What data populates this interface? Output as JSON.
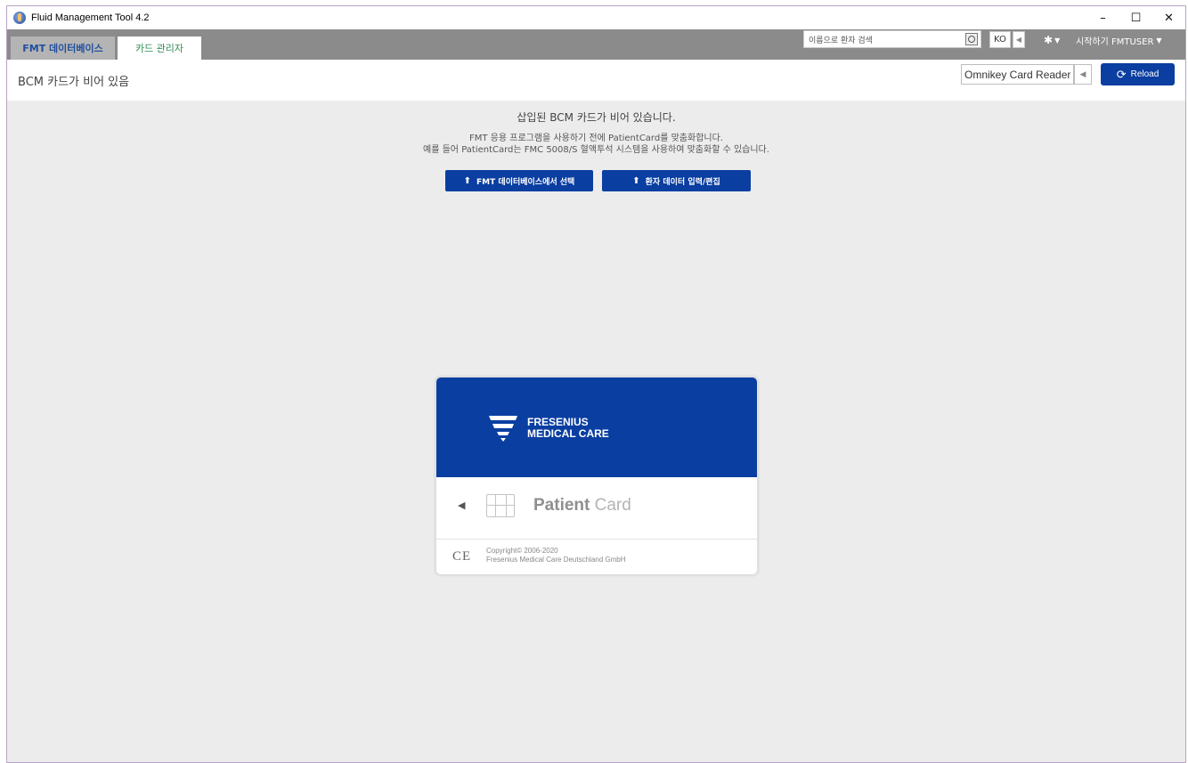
{
  "window": {
    "title": "Fluid Management Tool 4.2",
    "controls": {
      "minimize": "–",
      "maximize": "☐",
      "close": "✕"
    }
  },
  "tabs": [
    {
      "label": "FMT 데이터베이스",
      "active": false
    },
    {
      "label": "카드 관리자",
      "active": true
    }
  ],
  "header": {
    "search_placeholder": "이름으로 환자 검색",
    "language": "KO",
    "user_label": "시작하기 FMTUSER"
  },
  "subheader": {
    "status": "BCM 카드가 비어 있음",
    "reader": "Omnikey Card Reader",
    "reload_label": "Reload"
  },
  "message": {
    "title": "삽입된 BCM 카드가 비어 있습니다.",
    "line1": "FMT 응용 프로그램을 사용하기 전에 PatientCard를 맞춤화합니다.",
    "line2": "예를 들어 PatientCard는 FMC 5008/S 혈액투석 시스템을 사용하여 맞춤화할 수 있습니다."
  },
  "actions": {
    "select_from_db": "FMT 데이터베이스에서 선택",
    "edit_patient": "환자 데이터 입력/편집"
  },
  "card": {
    "brand_line1": "FRESENIUS",
    "brand_line2": "MEDICAL CARE",
    "label_strong": "Patient",
    "label_light": "Card",
    "ce": "CE",
    "copyright_line1": "Copyright© 2006-2020",
    "copyright_line2": "Fresenius Medical Care Deutschland GmbH"
  },
  "colors": {
    "brand_blue": "#0a3ea1",
    "tab_bar": "#8b8b8b",
    "active_tab_text": "#2e8b57"
  }
}
